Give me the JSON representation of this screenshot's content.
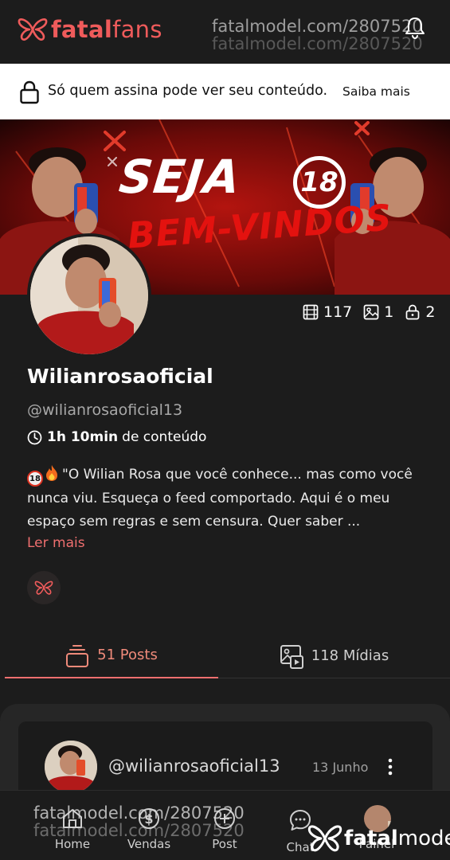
{
  "header": {
    "brand_first": "fatal",
    "brand_second": "fans",
    "watermark": "fatalmodel.com/2807520",
    "icons": [
      "butterfly-logo-icon",
      "bell-icon"
    ]
  },
  "notice": {
    "text": "Só quem assina pode ver seu conteúdo.",
    "link": "Saiba mais"
  },
  "banner": {
    "title": "SEJA",
    "age": "18",
    "subtitle": "BEM-VINDOS"
  },
  "profile": {
    "stats": {
      "videos": "117",
      "images": "1",
      "locked": "2"
    },
    "name": "Wilianrosaoficial",
    "handle": "@wilianrosaoficial13",
    "duration_value": "1h 10min",
    "duration_suffix": "de conteúdo",
    "bio": "\"O Wilian Rosa que você conhece... mas como você nunca viu. Esqueça o feed comportado. Aqui é o meu espaço sem regras e sem censura. Quer saber ...",
    "bio_badge": "18",
    "read_more": "Ler mais"
  },
  "tabs": [
    {
      "label": "51 Posts",
      "active": true
    },
    {
      "label": "118 Mídias",
      "active": false
    }
  ],
  "post": {
    "handle": "@wilianrosaoficial13",
    "date": "13 Junho"
  },
  "nav": {
    "home": "Home",
    "vendas": "Vendas",
    "post": "Post",
    "chat": "Chat",
    "painel": "Painel"
  },
  "footer_watermark": {
    "url": "fatalmodel.com/2807520",
    "brand_first": "fatal",
    "brand_second": "model"
  },
  "colors": {
    "accent": "#ef5b5b",
    "background": "#1c1c1c",
    "notice_bg": "#ffffff"
  }
}
